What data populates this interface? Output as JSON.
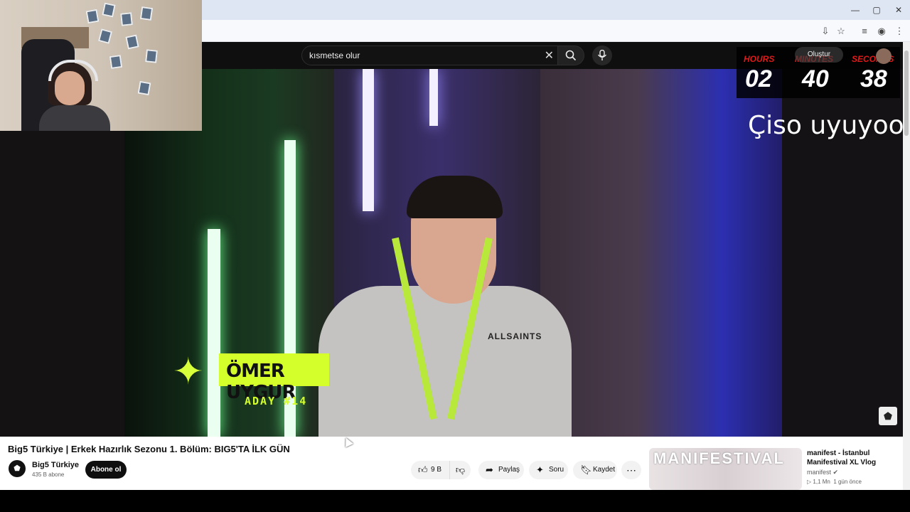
{
  "browser": {
    "window_controls": {
      "minimize": "—",
      "restore": "▢",
      "close": "✕"
    },
    "toolbar_icons": [
      "install-icon",
      "star-icon",
      "media-icon",
      "profile-icon",
      "menu-icon"
    ]
  },
  "header": {
    "search": {
      "value": "kısmetse olur",
      "clear": "✕"
    },
    "create_label": "Oluştur"
  },
  "timer": {
    "hours_label": "HOURS",
    "hours": "02",
    "minutes_label": "MINUTES",
    "minutes": "40",
    "seconds_label": "SECONDS",
    "seconds": "38"
  },
  "overlay_text": "Çiso uyuyooo",
  "video": {
    "brand_text": "ALLSAINTS",
    "name_tag": "ÖMER UYGUR",
    "aday": "ADAY #14"
  },
  "watch": {
    "title": "Big5 Türkiye | Erkek Hazırlık Sezonu 1. Bölüm: BIG5'TA İLK GÜN",
    "channel": {
      "name": "Big5 Türkiye",
      "subs": "435 B abone"
    },
    "subscribe_label": "Abone ol",
    "actions": {
      "likes": "9 B",
      "share": "Paylaş",
      "ask": "Soru",
      "save": "Kaydet"
    }
  },
  "recommendation": {
    "thumb_text": "MANIFESTIVAL",
    "title": "manifest - İstanbul Manifestival XL Vlog",
    "channel": "manifest",
    "views": "1,1 Mn",
    "age": "1 gün önce"
  }
}
